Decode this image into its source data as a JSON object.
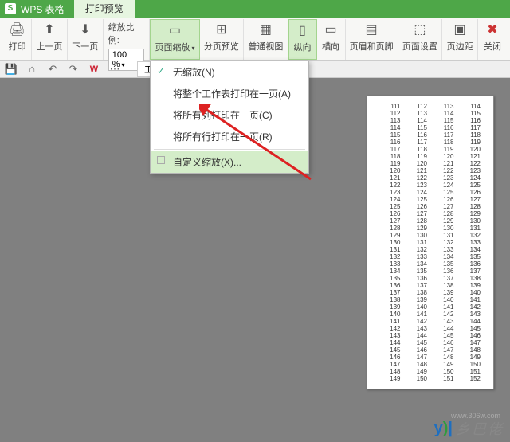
{
  "title": {
    "app": "WPS 表格",
    "tab": "打印预览"
  },
  "ribbon": {
    "print": "打印",
    "prev": "上一页",
    "next": "下一页",
    "zoom_label": "缩放比例:",
    "zoom_value": "100 %",
    "page_zoom": "页面缩放",
    "page_break": "分页预览",
    "normal_view": "普通视图",
    "portrait": "纵向",
    "landscape": "横向",
    "header_footer": "页眉和页脚",
    "page_setup": "页面设置",
    "margins": "页边距",
    "close": "关闭"
  },
  "worktab": {
    "name": "工",
    "close": "×",
    "plus": "+"
  },
  "menu": {
    "items": [
      {
        "label": "无缩放(N)",
        "checked": true
      },
      {
        "label": "将整个工作表打印在一页(A)"
      },
      {
        "label": "将所有列打印在一页(C)"
      },
      {
        "label": "将所有行打印在一页(R)"
      }
    ],
    "custom": "自定义缩放(X)..."
  },
  "preview_rows": [
    [
      111,
      112,
      113,
      114
    ],
    [
      112,
      113,
      114,
      115
    ],
    [
      113,
      114,
      115,
      116
    ],
    [
      114,
      115,
      116,
      117
    ],
    [
      115,
      116,
      117,
      118
    ],
    [
      116,
      117,
      118,
      119
    ],
    [
      117,
      118,
      119,
      120
    ],
    [
      118,
      119,
      120,
      121
    ],
    [
      119,
      120,
      121,
      122
    ],
    [
      120,
      121,
      122,
      123
    ],
    [
      121,
      122,
      123,
      124
    ],
    [
      122,
      123,
      124,
      125
    ],
    [
      123,
      124,
      125,
      126
    ],
    [
      124,
      125,
      126,
      127
    ],
    [
      125,
      126,
      127,
      128
    ],
    [
      126,
      127,
      128,
      129
    ],
    [
      127,
      128,
      129,
      130
    ],
    [
      128,
      129,
      130,
      131
    ],
    [
      129,
      130,
      131,
      132
    ],
    [
      130,
      131,
      132,
      133
    ],
    [
      131,
      132,
      133,
      134
    ],
    [
      132,
      133,
      134,
      135
    ],
    [
      133,
      134,
      135,
      136
    ],
    [
      134,
      135,
      136,
      137
    ],
    [
      135,
      136,
      137,
      138
    ],
    [
      136,
      137,
      138,
      139
    ],
    [
      137,
      138,
      139,
      140
    ],
    [
      138,
      139,
      140,
      141
    ],
    [
      139,
      140,
      141,
      142
    ],
    [
      140,
      141,
      142,
      143
    ],
    [
      141,
      142,
      143,
      144
    ],
    [
      142,
      143,
      144,
      145
    ],
    [
      143,
      144,
      145,
      146
    ],
    [
      144,
      145,
      146,
      147
    ],
    [
      145,
      146,
      147,
      148
    ],
    [
      146,
      147,
      148,
      149
    ],
    [
      147,
      148,
      149,
      150
    ],
    [
      148,
      149,
      150,
      151
    ],
    [
      149,
      150,
      151,
      152
    ]
  ],
  "watermark": {
    "text": "乡巴佬",
    "url": "www.306w.com"
  }
}
